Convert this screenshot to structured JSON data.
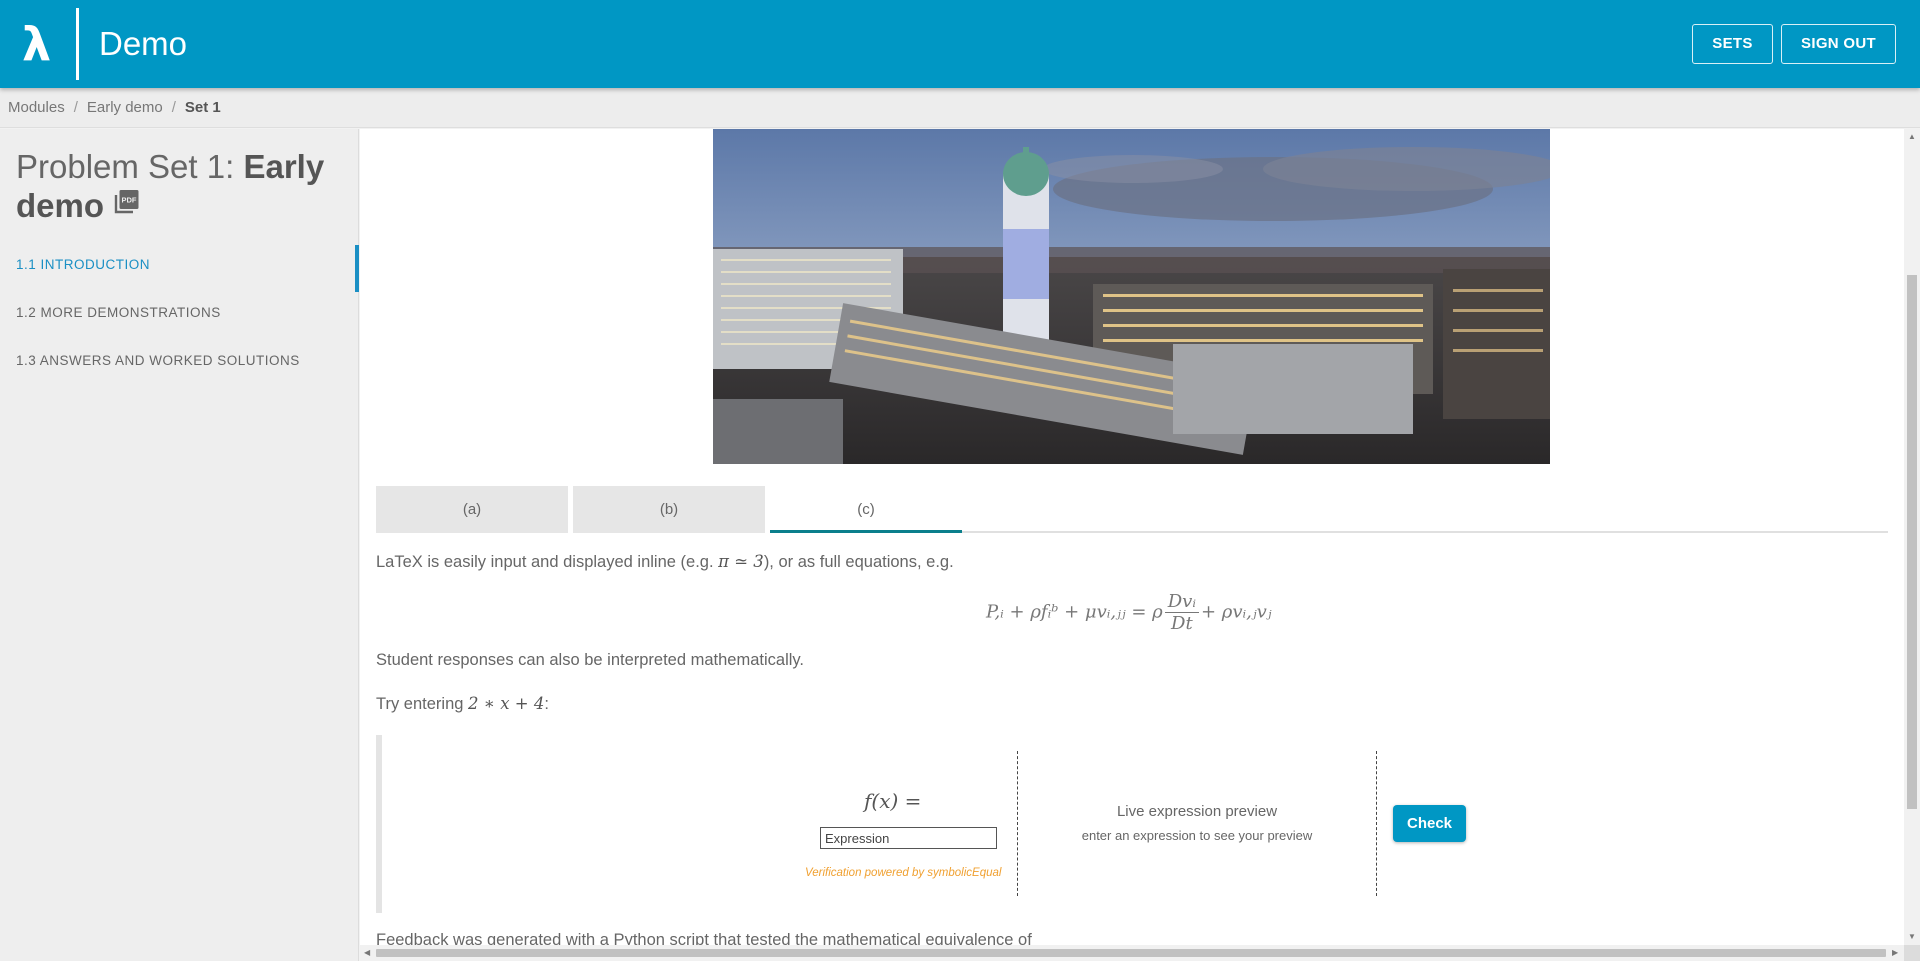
{
  "header": {
    "logo_glyph": "λ",
    "app_title": "Demo",
    "sets_label": "SETS",
    "signout_label": "SIGN OUT",
    "brand_color": "#0097c4"
  },
  "breadcrumb": {
    "items": [
      "Modules",
      "Early demo"
    ],
    "current": "Set 1",
    "separator": "/"
  },
  "sidebar": {
    "title_prefix": "Problem Set 1: ",
    "title_bold": "Early demo",
    "pdf_icon": "pdf-icon",
    "items": [
      {
        "label": "1.1 INTRODUCTION",
        "active": true
      },
      {
        "label": "1.2 MORE DEMONSTRATIONS",
        "active": false
      },
      {
        "label": "1.3 ANSWERS AND WORKED SOLUTIONS",
        "active": false
      }
    ],
    "active_color": "#1a8fc4"
  },
  "main": {
    "photo_icon": "campus-photo",
    "tabs": [
      {
        "label": "(a)",
        "active": false
      },
      {
        "label": "(b)",
        "active": false
      },
      {
        "label": "(c)",
        "active": true
      }
    ],
    "para1_before": "LaTeX is easily input and displayed inline (e.g. ",
    "para1_math": "π ≃ 3",
    "para1_after": "), or as full equations, e.g.",
    "equation_lhs": "P,ᵢ + ρfᵢᵇ + μvᵢ,ⱼⱼ = ρ",
    "equation_num": "Dvᵢ",
    "equation_den": "Dt",
    "equation_rhs": "+ ρvᵢ,ⱼvⱼ",
    "para2": "Student responses can also be interpreted mathematically.",
    "para3_before": "Try entering ",
    "para3_math": "2 ∗ x + 4",
    "para3_after": ":",
    "widget": {
      "fx_label": "f(x) =",
      "input_placeholder": "Expression",
      "input_value": "",
      "verification": "Verification powered by symbolicEqual",
      "preview_title": "Live expression preview",
      "preview_subtitle": "enter an expression to see your preview",
      "check_label": "Check"
    },
    "cut_para": "Feedback was generated with a Python script that tested the mathematical equivalence of"
  }
}
